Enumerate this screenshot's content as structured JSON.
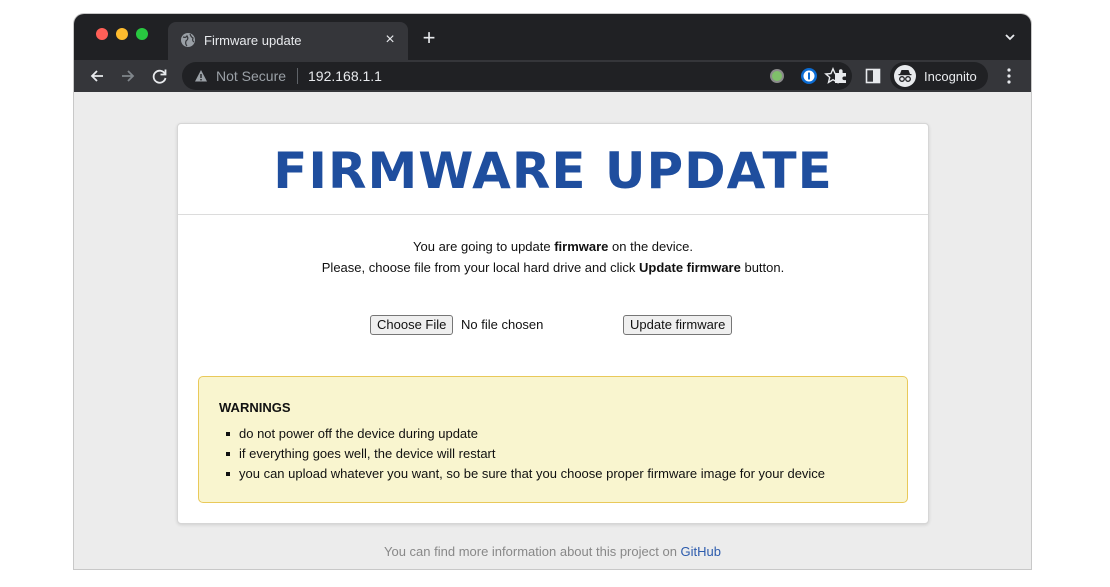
{
  "browser": {
    "tab_title": "Firmware update",
    "tab_close": "×",
    "new_tab": "+",
    "omnibox": {
      "security": "Not Secure",
      "url": "192.168.1.1"
    },
    "profile_label": "Incognito"
  },
  "page": {
    "title": "FIRMWARE UPDATE",
    "intro": {
      "line1_pre": "You are going to update ",
      "line1_bold": "firmware",
      "line1_post": " on the device.",
      "line2_pre": "Please, choose file from your local hard drive and click ",
      "line2_bold": "Update firmware",
      "line2_post": " button."
    },
    "file_input": {
      "button": "Choose File",
      "status": "No file chosen"
    },
    "submit_label": "Update firmware",
    "warnings": {
      "title": "WARNINGS",
      "items": [
        "do not power off the device during update",
        "if everything goes well, the device will restart",
        "you can upload whatever you want, so be sure that you choose proper firmware image for your device"
      ]
    },
    "footer": {
      "text": "You can find more information about this project on ",
      "link": "GitHub"
    }
  },
  "colors": {
    "title": "#1f4e9e",
    "warnings_bg": "#f9f5cf",
    "warnings_border": "#e9c95a",
    "link": "#2d5cad"
  }
}
